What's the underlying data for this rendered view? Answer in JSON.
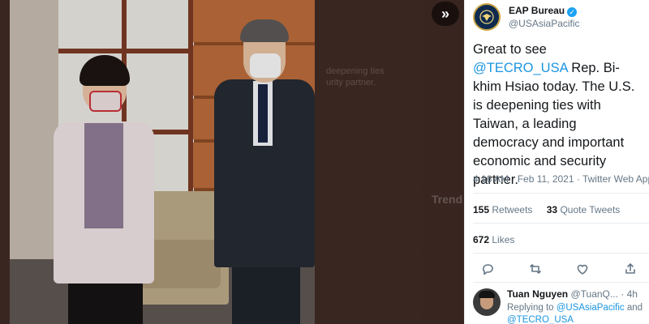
{
  "viewer": {
    "collapse_glyph": "»",
    "background_ghost_lines": [
      "deepening ties",
      "urity partner."
    ],
    "background_heading": "Trend"
  },
  "tweet": {
    "author": {
      "name": "EAP Bureau",
      "handle": "@USAsiaPacific",
      "verified": true,
      "avatar_icon": "department-of-state-seal-icon"
    },
    "text": {
      "intro": "Great to see ",
      "mention": "@TECRO_USA",
      "body": " Rep. Bi-khim Hsiao today. The U.S. is deepening ties with Taiwan, a leading democracy and important economic and security partner."
    },
    "meta": "4:16 AM · Feb 11, 2021 · Twitter Web App",
    "stats": {
      "retweets_count": "155",
      "retweets_label": "Retweets",
      "quotes_count": "33",
      "quotes_label": "Quote Tweets",
      "likes_count": "672",
      "likes_label": "Likes"
    },
    "actions": [
      "reply-icon",
      "retweet-icon",
      "like-icon",
      "share-icon"
    ]
  },
  "reply": {
    "name": "Tuan Nguyen",
    "handle": "@TuanQ...",
    "time": "· 4h",
    "replying_prefix": "Replying to ",
    "mention1": "@USAsiaPacific",
    "joiner": " and",
    "mention2": "@TECRO_USA"
  },
  "colors": {
    "accent": "#1b95e0",
    "verified": "#1da1f2",
    "text_primary": "#14171a",
    "text_secondary": "#657786"
  }
}
